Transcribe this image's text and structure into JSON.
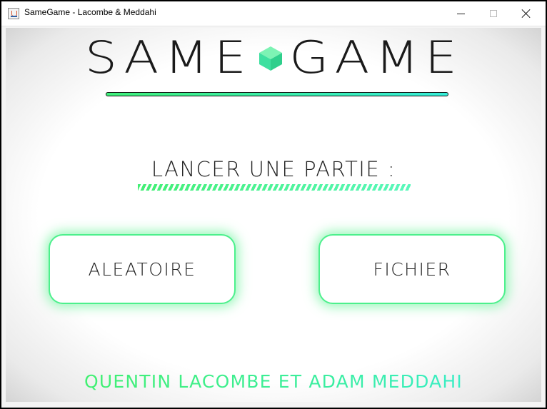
{
  "window": {
    "title": "SameGame - Lacombe & Meddahi",
    "icon": "java-app-icon",
    "controls": [
      "minimize-icon",
      "maximize-icon",
      "close-icon"
    ]
  },
  "header": {
    "word_left": "SAME",
    "word_right": "GAME",
    "logo_icon": "cube-icon"
  },
  "section": {
    "title": "LANCER UNE PARTIE :"
  },
  "buttons": {
    "random_label": "ALEATOIRE",
    "file_label": "FICHIER"
  },
  "footer": {
    "credits": "QUENTIN LACOMBE ET ADAM MEDDAHI"
  },
  "colors": {
    "accent_green": "#3ff07a",
    "accent_cyan": "#35eed9",
    "text_dark": "#1a1a1a"
  }
}
